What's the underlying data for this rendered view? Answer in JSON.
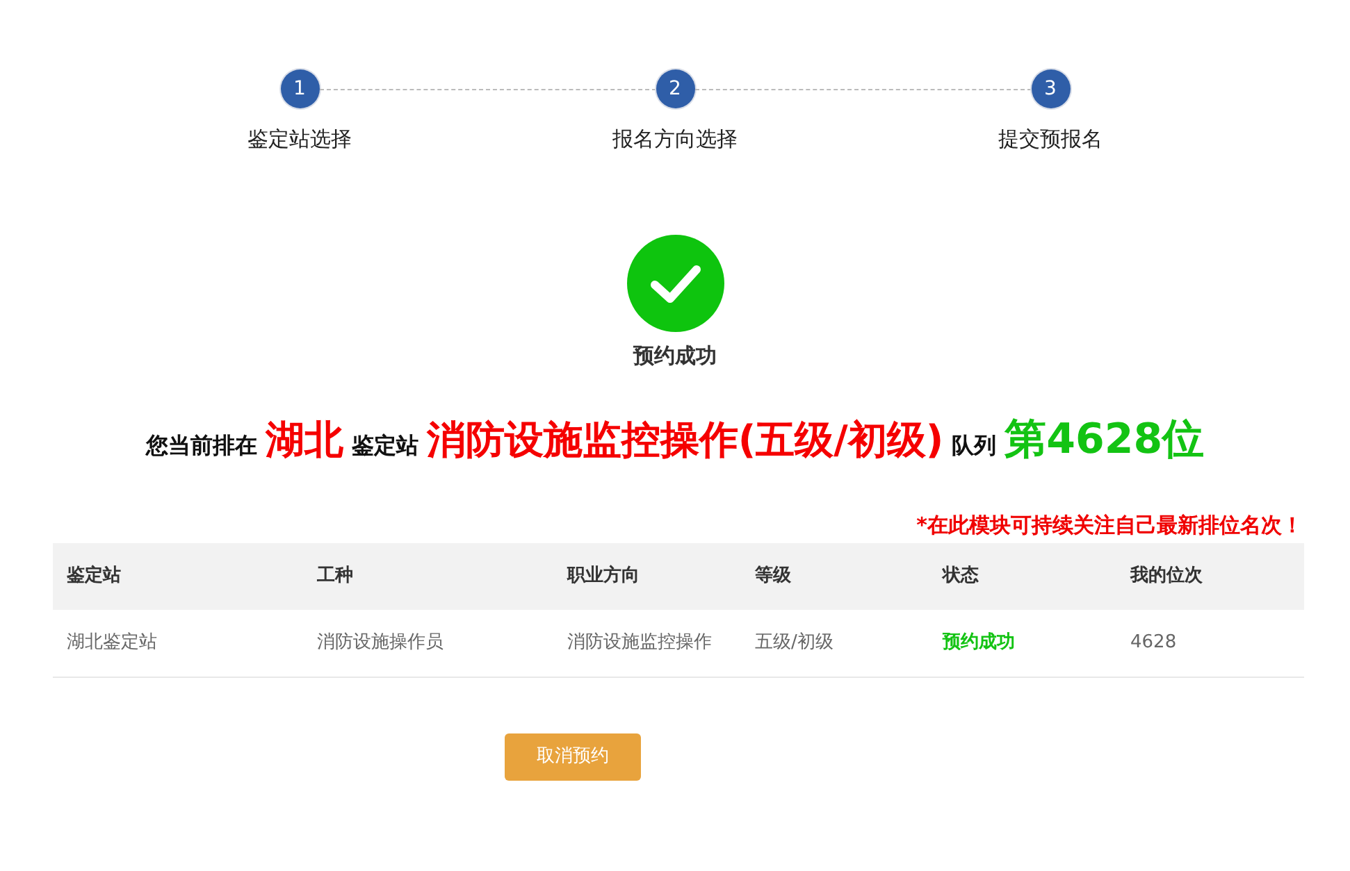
{
  "steps": [
    {
      "number": "1",
      "label": "鉴定站选择"
    },
    {
      "number": "2",
      "label": "报名方向选择"
    },
    {
      "number": "3",
      "label": "提交预报名"
    }
  ],
  "result": {
    "status": "预约成功"
  },
  "queue_line": [
    {
      "text": "您当前排在",
      "kind": "label"
    },
    {
      "text": "湖北",
      "kind": "value"
    },
    {
      "text": "鉴定站",
      "kind": "label"
    },
    {
      "text": "消防设施监控操作(五级/初级)",
      "kind": "value"
    },
    {
      "text": "队列",
      "kind": "label"
    },
    {
      "text": "第4628位",
      "kind": "rank"
    }
  ],
  "notice": "*在此模块可持续关注自己最新排位名次！",
  "table": {
    "columns": [
      "鉴定站",
      "工种",
      "职业方向",
      "等级",
      "状态",
      "我的位次"
    ],
    "rows": [
      [
        {
          "text": "湖北鉴定站",
          "kind": "plain"
        },
        {
          "text": "消防设施操作员",
          "kind": "plain"
        },
        {
          "text": "消防设施监控操作",
          "kind": "plain"
        },
        {
          "text": "五级/初级",
          "kind": "plain"
        },
        {
          "text": "预约成功",
          "kind": "status"
        },
        {
          "text": "4628",
          "kind": "plain"
        }
      ]
    ]
  },
  "cancel_button": {
    "label": "取消预约"
  }
}
